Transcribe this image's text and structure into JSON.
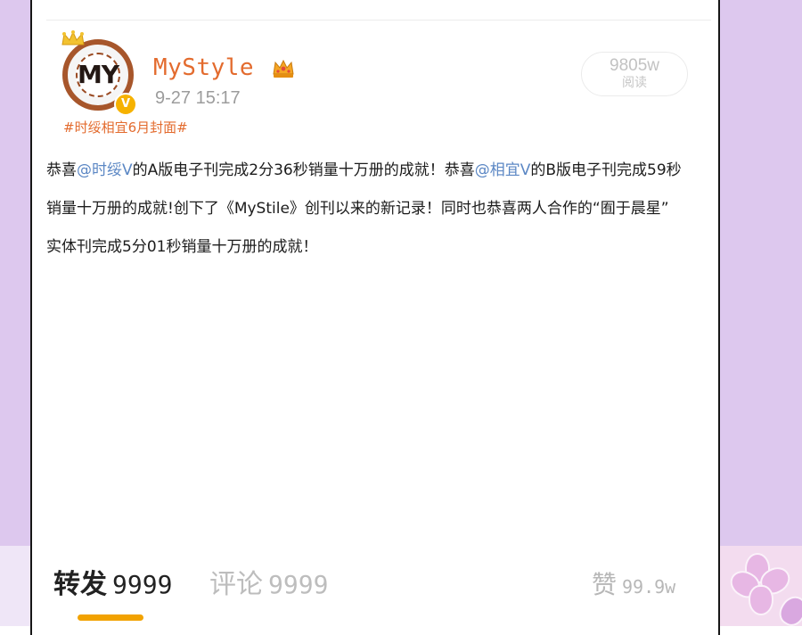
{
  "post": {
    "username": "MyStyle",
    "timestamp": "9-27 15:17",
    "hashtag": "#时绥相宜6月封面#",
    "avatar_text": "MY",
    "verified_badge": "V",
    "reads": {
      "count": "9805w",
      "label": "阅读"
    },
    "content": {
      "line1": {
        "prefix1": "恭喜",
        "mention1": "@时绥V",
        "mid1": "的A版电子刊完成2分36秒销量十万册的成就！恭喜",
        "mention2": "@相宜V",
        "suffix1": "的B版电子刊完成59秒"
      },
      "line2": "销量十万册的成就!创下了《MyStile》创刊以来的新记录！同时也恭喜两人合作的“囿于晨星”",
      "line3": "实体刊完成5分01秒销量十万册的成就！"
    }
  },
  "actions": {
    "forward": {
      "label": "转发",
      "count": "9999"
    },
    "comment": {
      "label": "评论",
      "count": "9999"
    },
    "like": {
      "label": "赞",
      "count": "99.9w"
    }
  },
  "colors": {
    "accent_orange": "#e36b2e",
    "mention_blue": "#5b87c4",
    "tab_indicator": "#f2a200",
    "background_lilac": "#ddc8ee"
  },
  "icons": {
    "crown": "crown-icon",
    "vip": "vip-crown-badge-icon",
    "verified": "verified-badge-icon"
  }
}
